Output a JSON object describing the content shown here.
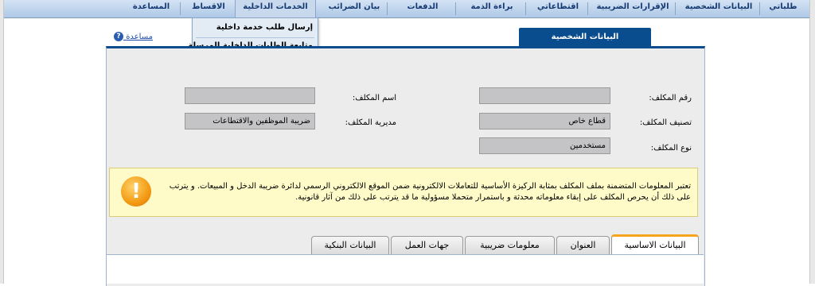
{
  "nav": {
    "items": [
      {
        "label": "طلباتي"
      },
      {
        "label": "البيانات الشخصية"
      },
      {
        "label": "الإقرارات الضريبية"
      },
      {
        "label": "اقتطاعاتي"
      },
      {
        "label": "براءة الذمة"
      },
      {
        "label": "الدفعات"
      },
      {
        "label": "بيان الضرائب"
      },
      {
        "label": "الخدمات الداخلية"
      },
      {
        "label": "الاقساط"
      },
      {
        "label": "المساعدة"
      }
    ],
    "dropdown": [
      {
        "label": "إرسال طلب خدمة داخلية"
      },
      {
        "label": "متابعة الطلبات الداخلية المرسلة"
      }
    ]
  },
  "help": {
    "label": "مساعدة",
    "icon": "?"
  },
  "section": {
    "title": "البيانات الشخصية"
  },
  "form": {
    "taxpayer_no_label": "رقم المكلف:",
    "taxpayer_no_value": "",
    "taxpayer_name_label": "اسم المكلف:",
    "taxpayer_name_value": "",
    "category_label": "تصنيف المكلف:",
    "category_value": "قطاع خاص",
    "directorate_label": "مديرية المكلف:",
    "directorate_value": "ضريبة الموظفين والاقتطاعات",
    "type_label": "نوع المكلف:",
    "type_value": "مستخدمين"
  },
  "notice": {
    "icon": "!",
    "text": "تعتبر المعلومات المتضمنة بملف المكلف بمثابة الركيزة الأساسية للتعاملات الالكترونية ضمن الموقع الالكتروني الرسمي لدائرة ضريبة الدخل و المبيعات. و يترتب على ذلك أن يحرص المكلف على إبقاء معلوماته محدثة و باستمرار متحملا مسؤولية ما قد يترتب على ذلك من آثار قانونية."
  },
  "tabs": [
    {
      "label": "البيانات الاساسية"
    },
    {
      "label": "العنوان"
    },
    {
      "label": "معلومات ضريبية"
    },
    {
      "label": "جهات العمل"
    },
    {
      "label": "البيانات البنكية"
    }
  ],
  "colors": {
    "nav_text": "#153a72",
    "section_tab": "#0a4d8e",
    "active_tab_accent": "#f4a51c",
    "notice_bg": "#fefbc9"
  }
}
